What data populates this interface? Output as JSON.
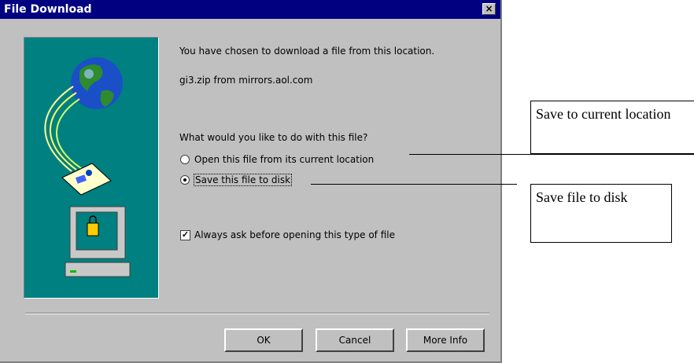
{
  "dialog": {
    "title": "File Download",
    "message": "You have chosen to download a file from this location.",
    "file_source": "gi3.zip from mirrors.aol.com",
    "question": "What would you like to do with this file?",
    "options": [
      {
        "label": "Open this file from its current location",
        "selected": false
      },
      {
        "label": "Save this file to disk",
        "selected": true
      }
    ],
    "always_ask_label": "Always ask before opening this type of file",
    "always_ask_checked": true,
    "buttons": {
      "ok": "OK",
      "cancel": "Cancel",
      "more_info": "More Info"
    }
  },
  "callouts": {
    "save_location": "Save to current location",
    "save_disk": "Save file to disk"
  }
}
